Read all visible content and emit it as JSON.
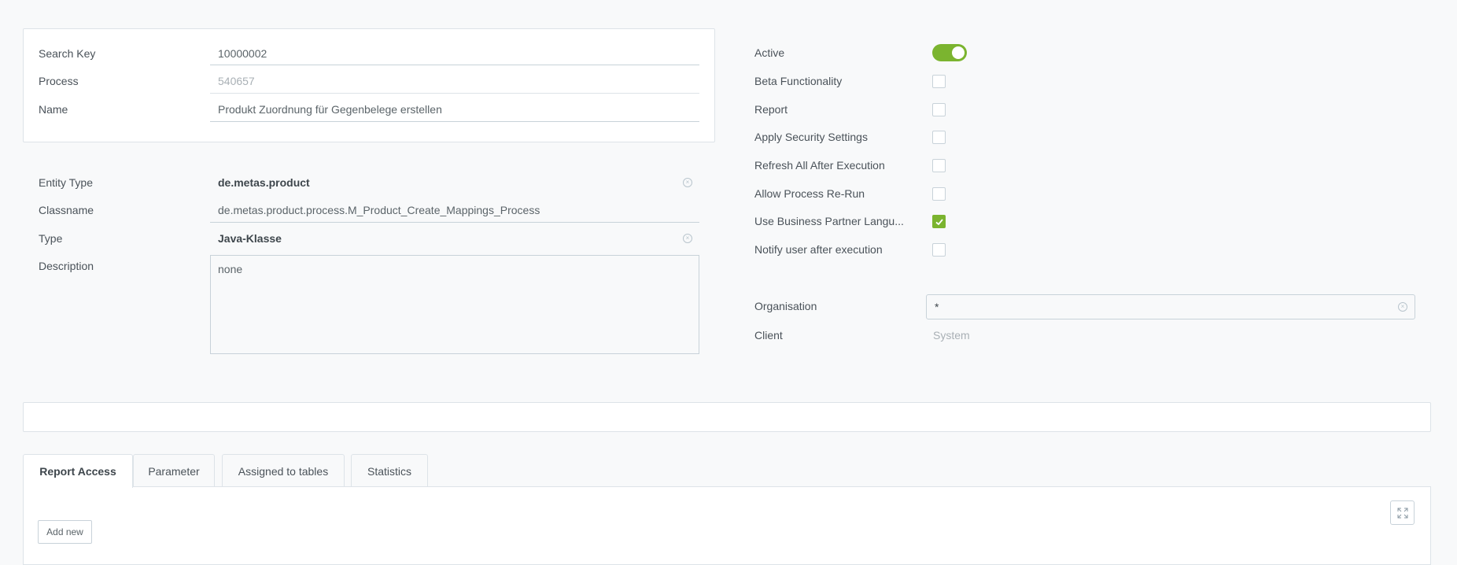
{
  "main_fields": {
    "search_key": {
      "label": "Search Key",
      "value": "10000002"
    },
    "process": {
      "label": "Process",
      "value": "540657"
    },
    "name": {
      "label": "Name",
      "value": "Produkt Zuordnung für Gegenbelege erstellen"
    }
  },
  "details": {
    "entity_type": {
      "label": "Entity Type",
      "value": "de.metas.product",
      "icon": "clear-icon"
    },
    "classname": {
      "label": "Classname",
      "value": "de.metas.product.process.M_Product_Create_Mappings_Process"
    },
    "type": {
      "label": "Type",
      "value": "Java-Klasse",
      "icon": "clear-icon"
    },
    "description": {
      "label": "Description",
      "value": "none"
    }
  },
  "flags": {
    "active": {
      "label": "Active",
      "checked": true
    },
    "items": [
      {
        "label": "Beta Functionality",
        "checked": false
      },
      {
        "label": "Report",
        "checked": false
      },
      {
        "label": "Apply Security Settings",
        "checked": false
      },
      {
        "label": "Refresh All After Execution",
        "checked": false
      },
      {
        "label": "Allow Process Re-Run",
        "checked": false
      },
      {
        "label": "Use Business Partner Langu...",
        "checked": true
      },
      {
        "label": "Notify user after execution",
        "checked": false
      }
    ]
  },
  "organisation": {
    "label": "Organisation",
    "value": "*",
    "icon": "clear-icon"
  },
  "client": {
    "label": "Client",
    "value": "System"
  },
  "tabs": [
    {
      "label": "Report Access",
      "active": true
    },
    {
      "label": "Parameter",
      "active": false
    },
    {
      "label": "Assigned to tables",
      "active": false
    },
    {
      "label": "Statistics",
      "active": false
    }
  ],
  "tab_panel": {
    "add_new_label": "Add new",
    "expand_icon": "expand-icon"
  },
  "colors": {
    "accent": "#7bb42f",
    "background": "#f8f9fa",
    "border": "#dde3e8"
  }
}
